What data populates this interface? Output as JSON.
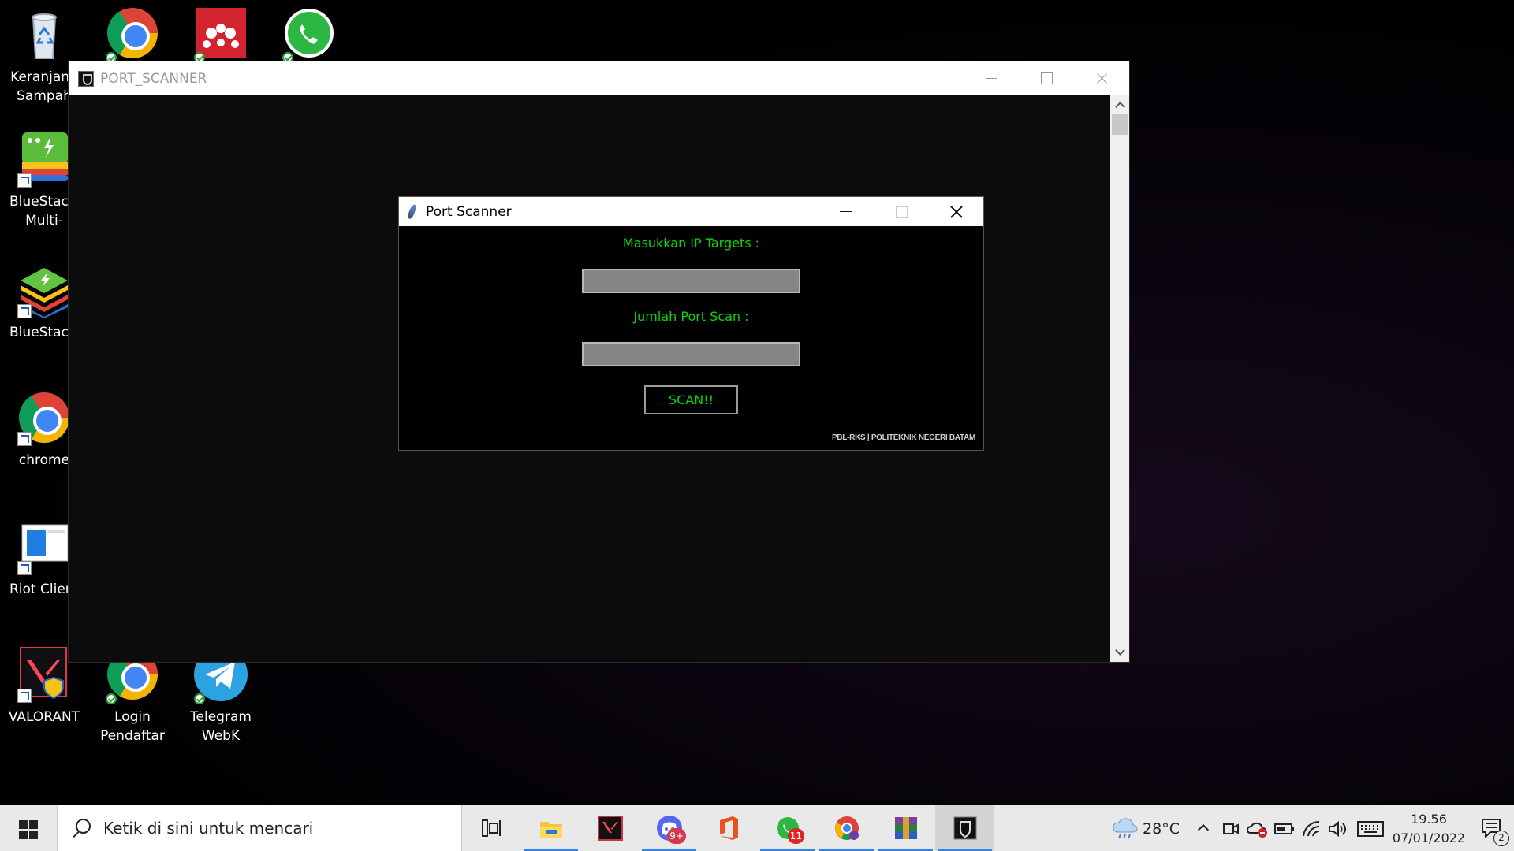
{
  "desktop": {
    "icons": [
      {
        "label": "Keranjang Sampah",
        "name": "recycle-bin"
      },
      {
        "label": "BlueStacks Multi-Instance",
        "name": "bluestacks-multi-instance"
      },
      {
        "label": "BlueStacks",
        "name": "bluestacks"
      },
      {
        "label": "chrome",
        "name": "chrome"
      },
      {
        "label": "Riot Client",
        "name": "riot-client"
      },
      {
        "label": "VALORANT",
        "name": "valorant"
      },
      {
        "label": "Login Pendaftar",
        "name": "login-pendaftar"
      },
      {
        "label": "Telegram WebK",
        "name": "telegram-webk"
      }
    ],
    "top_row_icons": [
      "chrome",
      "mendeley",
      "whatsapp"
    ]
  },
  "main_window": {
    "title": "PORT_SCANNER"
  },
  "dialog": {
    "title": "Port Scanner",
    "ip_label": "Masukkan IP Targets :",
    "ip_value": "",
    "port_label": "Jumlah Port Scan :",
    "port_value": "",
    "scan_button": "SCAN!!",
    "footer": "PBL-RKS | POLITEKNIK NEGERI BATAM",
    "accent_color": "#0bd60b"
  },
  "taskbar": {
    "search_placeholder": "Ketik di sini untuk mencari",
    "apps": [
      {
        "name": "task-view",
        "icon": "task-view-icon"
      },
      {
        "name": "file-explorer",
        "icon": "folder-icon"
      },
      {
        "name": "valorant",
        "icon": "valorant-icon"
      },
      {
        "name": "discord",
        "icon": "discord-icon",
        "badge": "9+"
      },
      {
        "name": "office",
        "icon": "office-icon"
      },
      {
        "name": "whatsapp",
        "icon": "whatsapp-icon",
        "badge": "11"
      },
      {
        "name": "chrome",
        "icon": "chrome-icon"
      },
      {
        "name": "winrar",
        "icon": "winrar-icon"
      },
      {
        "name": "port-scanner",
        "icon": "port-scanner-icon"
      }
    ],
    "weather": "28°C",
    "time": "19.56",
    "date": "07/01/2022",
    "notification_count": "2"
  }
}
